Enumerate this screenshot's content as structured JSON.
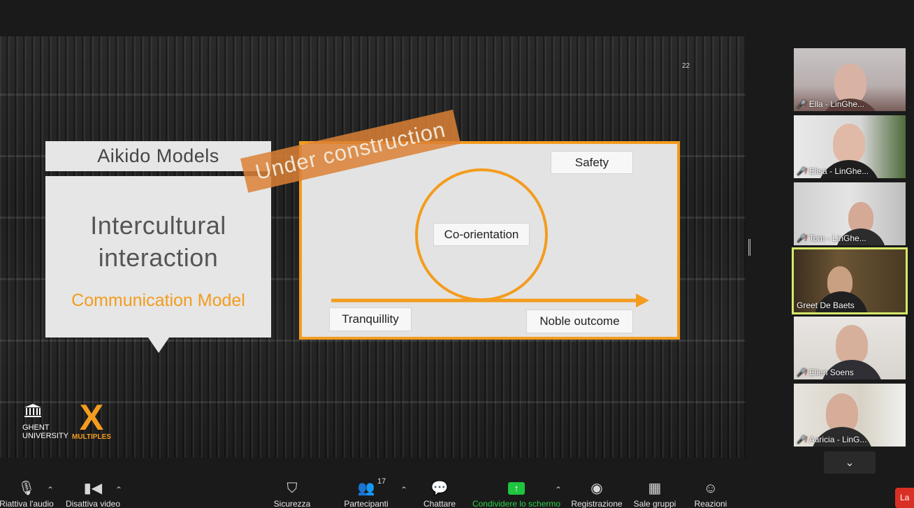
{
  "slide": {
    "page_number": "22",
    "title": "Aikido Models",
    "main_text_line1": "Intercultural",
    "main_text_line2": "interaction",
    "subtitle": "Communication Model",
    "banner": "Under construction",
    "diagram": {
      "labels": {
        "safety": "Safety",
        "center": "Co-orientation",
        "start": "Tranquillity",
        "end": "Noble outcome"
      }
    },
    "logos": {
      "ghent_line1": "GHENT",
      "ghent_line2": "UNIVERSITY",
      "multiples_mark": "X",
      "multiples_text": "MULTIPLES"
    }
  },
  "participants": [
    {
      "name": "Ella - LinGhe...",
      "muted": true
    },
    {
      "name": "Elisa - LinGhe...",
      "muted": true
    },
    {
      "name": "Tom - LinGhe...",
      "muted": true
    },
    {
      "name": "Greet De Baets",
      "muted": false,
      "active": true
    },
    {
      "name": "Ellen Soens",
      "muted": true
    },
    {
      "name": "Aaricia - LinG...",
      "muted": true
    }
  ],
  "toolbar": {
    "audio": "Riattiva l'audio",
    "video": "Disattiva video",
    "security": "Sicurezza",
    "participants": "Partecipanti",
    "participants_count": "17",
    "chat": "Chattare",
    "share": "Condividere lo schermo",
    "record": "Registrazione",
    "breakout": "Sale gruppi",
    "reactions": "Reazioni",
    "leave": "La"
  },
  "colors": {
    "accent": "#f39c1e",
    "share_green": "#2bd14b",
    "leave_red": "#d93025",
    "active_outline": "#d6e86a"
  }
}
